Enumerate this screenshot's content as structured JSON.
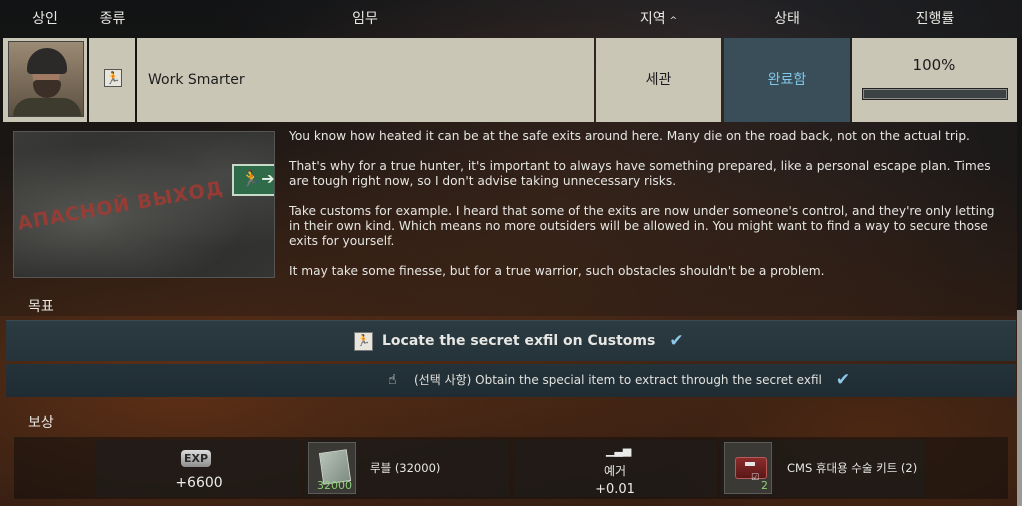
{
  "header": {
    "trader": "상인",
    "type": "종류",
    "quest": "임무",
    "region": "지역",
    "sort_indicator": "^",
    "status": "상태",
    "progress": "진행률"
  },
  "quest": {
    "trader_avatar_icon": "trader-portrait",
    "type_icon": "exit-running-man-icon",
    "name": "Work Smarter",
    "region": "세관",
    "status": "완료함",
    "status_color": "#7fc6e8",
    "progress_text": "100%",
    "progress_fraction": 1.0
  },
  "description": {
    "image_text": "АПАСНОЙ ВЫХОД",
    "paragraphs": [
      "You know how heated it can be at the safe exits around here. Many die on the road back, not on the actual trip.",
      "That's why for a true hunter, it's important to always have something prepared, like a personal escape plan. Times are tough right now, so I don't advise taking unnecessary risks.",
      "Take customs for example. I heard that some of the exits are now under someone's control, and they're only letting in their own kind. Which means no more outsiders will be allowed in. You might want to find a way to secure those exits for yourself.",
      "It may take some finesse, but for a true warrior, such obstacles shouldn't be a problem."
    ]
  },
  "objectives": {
    "label": "목표",
    "main": {
      "icon": "exit-running-man-icon",
      "text": "Locate the secret exfil on Customs",
      "completed_icon": "checkmark-icon"
    },
    "optional": {
      "icon": "hand-pointer-icon",
      "text": "(선택 사항) Obtain the special item to extract through the secret exfil",
      "completed_icon": "checkmark-icon"
    }
  },
  "rewards": {
    "label": "보상",
    "exp": {
      "badge": "EXP",
      "value": "+6600"
    },
    "roubles": {
      "count": "32000",
      "label": "루블  (32000)"
    },
    "reputation": {
      "icon": "signal-bars-icon",
      "label": "예거",
      "value": "+0.01"
    },
    "item": {
      "count": "2",
      "label": "CMS 휴대용 수술 키트  (2)"
    }
  }
}
